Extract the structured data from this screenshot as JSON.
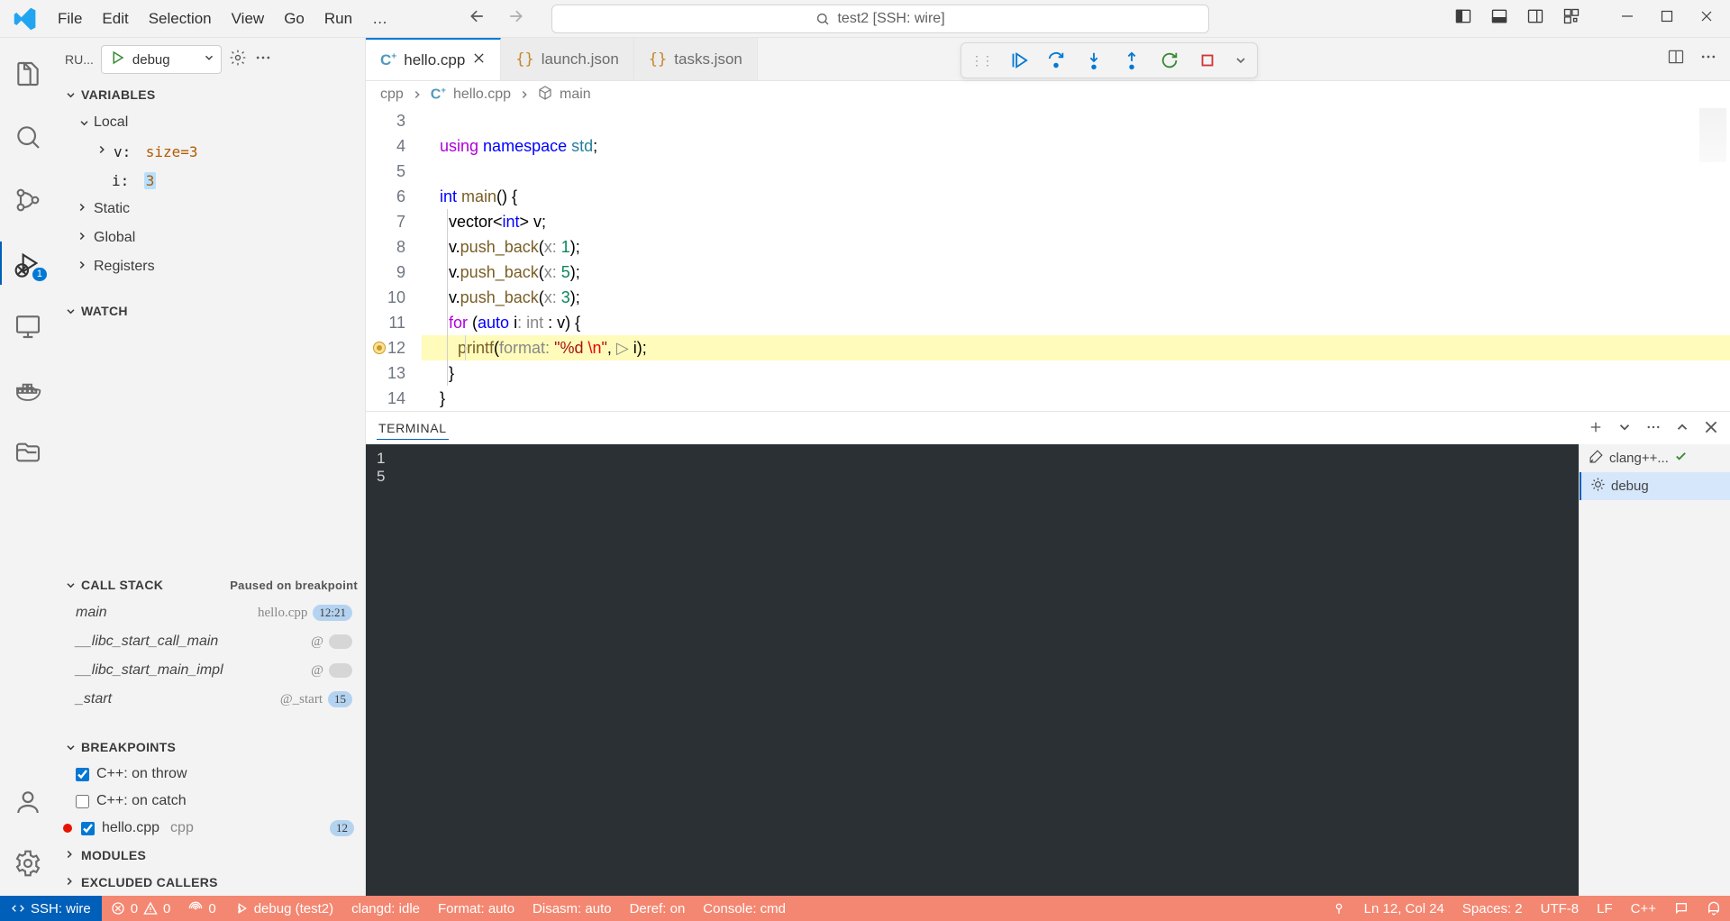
{
  "menu": [
    "File",
    "Edit",
    "Selection",
    "View",
    "Go",
    "Run",
    "…"
  ],
  "search_label": "test2 [SSH: wire]",
  "sidebar": {
    "run_trunc": "RU...",
    "config": "debug",
    "sections": {
      "variables": "VARIABLES",
      "watch": "WATCH",
      "callstack": "CALL STACK",
      "callstack_status": "Paused on breakpoint",
      "breakpoints": "BREAKPOINTS",
      "modules": "MODULES",
      "excluded": "EXCLUDED CALLERS"
    },
    "locals_label": "Local",
    "static_label": "Static",
    "global_label": "Global",
    "registers_label": "Registers",
    "var_v": {
      "name": "v:",
      "val": "size=3"
    },
    "var_i": {
      "name": "i:",
      "val": "3"
    },
    "callstack": [
      {
        "fn": "main",
        "src": "hello.cpp",
        "pill": "12:21"
      },
      {
        "fn": "__libc_start_call_main",
        "src": "@",
        "pill": ""
      },
      {
        "fn": "__libc_start_main_impl",
        "src": "@",
        "pill": ""
      },
      {
        "fn": "_start",
        "src": "@_start",
        "pill": "15"
      }
    ],
    "bps": [
      {
        "label": "C++: on throw",
        "checked": true
      },
      {
        "label": "C++: on catch",
        "checked": false
      }
    ],
    "bp_file": {
      "label": "hello.cpp",
      "src": "cpp",
      "count": "12"
    }
  },
  "tabs": [
    {
      "label": "hello.cpp",
      "kind": "cpp",
      "active": true
    },
    {
      "label": "launch.json",
      "kind": "json",
      "active": false
    },
    {
      "label": "tasks.json",
      "kind": "json",
      "active": false
    }
  ],
  "breadcrumb": {
    "a": "cpp",
    "b": "hello.cpp",
    "c": "main"
  },
  "code": {
    "start": 3,
    "lines": [
      {
        "n": 3,
        "html": ""
      },
      {
        "n": 4,
        "html": "<span class='tok-ctrl'>using</span> <span class='tok-kw'>namespace</span> <span class='tok-ns'>std</span>;"
      },
      {
        "n": 5,
        "html": ""
      },
      {
        "n": 6,
        "html": "<span class='tok-kw'>int</span> <span class='tok-fn'>main</span>() {"
      },
      {
        "n": 7,
        "html": "<span class='indentbar'></span>  vector&lt;<span class='tok-kw'>int</span>&gt; v;"
      },
      {
        "n": 8,
        "html": "<span class='indentbar'></span>  v.<span class='tok-fn'>push_back</span>(<span class='tok-hint'>x: </span><span class='tok-num'>1</span>);"
      },
      {
        "n": 9,
        "html": "<span class='indentbar'></span>  v.<span class='tok-fn'>push_back</span>(<span class='tok-hint'>x: </span><span class='tok-num'>5</span>);"
      },
      {
        "n": 10,
        "html": "<span class='indentbar'></span>  v.<span class='tok-fn'>push_back</span>(<span class='tok-hint'>x: </span><span class='tok-num'>3</span>);"
      },
      {
        "n": 11,
        "html": "<span class='indentbar'></span>  <span class='tok-ctrl'>for</span> (<span class='tok-kw'>auto</span> i<span class='tok-hint'>: int</span> : v) {"
      },
      {
        "n": 12,
        "hl": true,
        "bp": true,
        "html": "<span class='indentbar'></span><span class='indentbar i2'></span>    <span class='tok-fn'>printf</span>(<span class='tok-hint'>format: </span><span class='tok-str'>\"%d </span><span class='tok-esc'>\\n</span><span class='tok-str'>\"</span>, <span class='tok-hint'>▷ </span>i);"
      },
      {
        "n": 13,
        "html": "<span class='indentbar'></span>  }"
      },
      {
        "n": 14,
        "html": "}"
      }
    ]
  },
  "panel": {
    "tab": "TERMINAL",
    "output": "1\n5",
    "terms": [
      {
        "label": "clang++...",
        "active": false,
        "ok": true
      },
      {
        "label": "debug",
        "active": true,
        "ok": false
      }
    ]
  },
  "status": {
    "remote": "SSH: wire",
    "errors": "0",
    "warnings": "0",
    "ports": "0",
    "debug": "debug (test2)",
    "clangd": "clangd: idle",
    "format": "Format: auto",
    "disasm": "Disasm: auto",
    "deref": "Deref: on",
    "console": "Console: cmd",
    "pos": "Ln 12, Col 24",
    "spaces": "Spaces: 2",
    "enc": "UTF-8",
    "eol": "LF",
    "lang": "C++"
  }
}
